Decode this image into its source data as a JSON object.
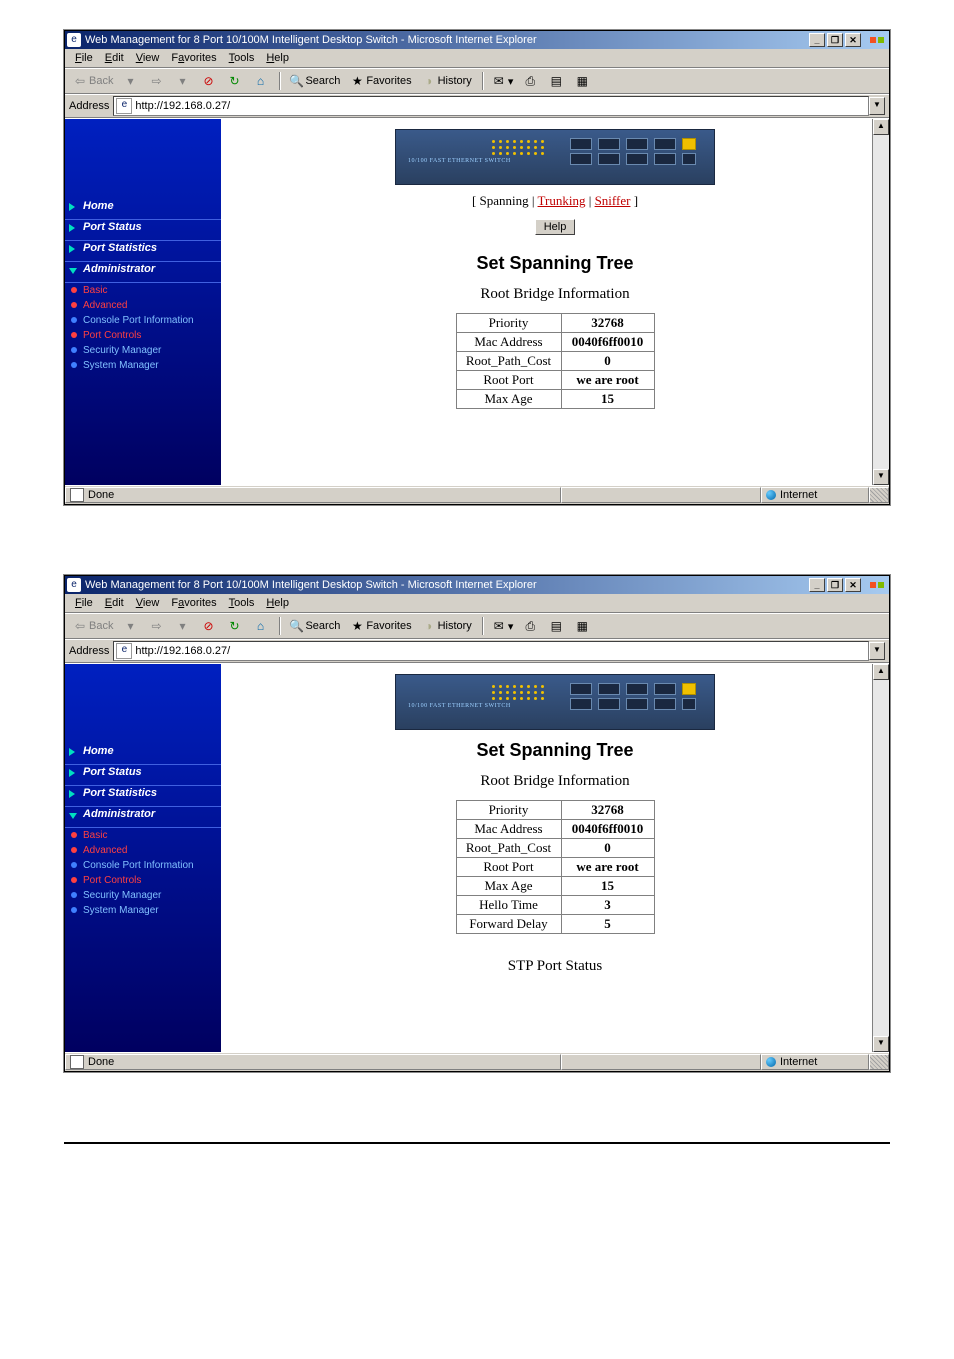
{
  "window": {
    "title": "Web Management for 8 Port 10/100M Intelligent Desktop Switch - Microsoft Internet Explorer",
    "min": "_",
    "max": "❐",
    "close": "✕"
  },
  "menu": {
    "file": "File",
    "edit": "Edit",
    "view": "View",
    "favorites": "Favorites",
    "tools": "Tools",
    "help": "Help"
  },
  "toolbar": {
    "back": "Back",
    "search": "Search",
    "favorites": "Favorites",
    "history": "History"
  },
  "address": {
    "label": "Address",
    "url": "http://192.168.0.27/"
  },
  "sidebar": {
    "home": "Home",
    "port_status": "Port Status",
    "port_statistics": "Port Statistics",
    "administrator": "Administrator",
    "subs": {
      "basic": "Basic",
      "advanced": "Advanced",
      "console": "Console Port Information",
      "port_controls": "Port Controls",
      "security": "Security Manager",
      "system": "System Manager"
    }
  },
  "switch_label": "10/100 FAST ETHERNET SWITCH",
  "breadcrumb": {
    "open": "[ ",
    "spanning": "Spanning",
    "sep1": " | ",
    "trunking": "Trunking",
    "sep2": " | ",
    "sniffer": "Sniffer",
    "close": " ]"
  },
  "help": "Help",
  "heading": "Set Spanning Tree",
  "subheading": "Root Bridge Information",
  "stp_port_status": "STP Port Status",
  "table1": [
    {
      "k": "Priority",
      "v": "32768"
    },
    {
      "k": "Mac Address",
      "v": "0040f6ff0010"
    },
    {
      "k": "Root_Path_Cost",
      "v": "0"
    },
    {
      "k": "Root Port",
      "v": "we are root"
    },
    {
      "k": "Max Age",
      "v": "15"
    }
  ],
  "table2": [
    {
      "k": "Priority",
      "v": "32768"
    },
    {
      "k": "Mac Address",
      "v": "0040f6ff0010"
    },
    {
      "k": "Root_Path_Cost",
      "v": "0"
    },
    {
      "k": "Root Port",
      "v": "we are root"
    },
    {
      "k": "Max Age",
      "v": "15"
    },
    {
      "k": "Hello Time",
      "v": "3"
    },
    {
      "k": "Forward Delay",
      "v": "5"
    }
  ],
  "status": {
    "done": "Done",
    "zone": "Internet"
  }
}
